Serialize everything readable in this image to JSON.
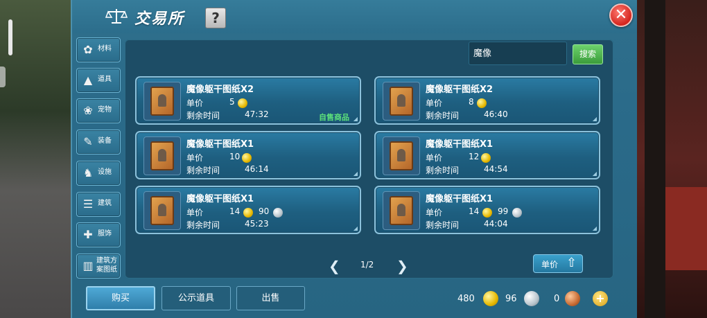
{
  "window": {
    "title": "交易所",
    "help_label": "?",
    "close_label": "✕"
  },
  "categories": [
    {
      "label": "材料",
      "icon": "materials-icon",
      "glyph": "✿"
    },
    {
      "label": "道具",
      "icon": "props-icon",
      "glyph": "▲"
    },
    {
      "label": "宠物",
      "icon": "pet-paw-icon",
      "glyph": "❀"
    },
    {
      "label": "装备",
      "icon": "sword-icon",
      "glyph": "✎"
    },
    {
      "label": "设施",
      "icon": "facility-icon",
      "glyph": "♞"
    },
    {
      "label": "建筑",
      "icon": "building-icon",
      "glyph": "☰"
    },
    {
      "label": "服饰",
      "icon": "clothing-icon",
      "glyph": "✚"
    },
    {
      "label": "建筑方案图纸",
      "icon": "blueprint-icon",
      "glyph": "▥"
    }
  ],
  "search": {
    "value": "魔像",
    "button_label": "搜索"
  },
  "listing_labels": {
    "price": "单价",
    "time_left": "剩余时间",
    "self_tag": "自售商品"
  },
  "listings": [
    {
      "name": "魔像躯干图纸X2",
      "gold": "5",
      "silver": "",
      "time": "47:32",
      "self": true
    },
    {
      "name": "魔像躯干图纸X2",
      "gold": "8",
      "silver": "",
      "time": "46:40",
      "self": false
    },
    {
      "name": "魔像躯干图纸X1",
      "gold": "10",
      "silver": "",
      "time": "46:14",
      "self": false
    },
    {
      "name": "魔像躯干图纸X1",
      "gold": "12",
      "silver": "",
      "time": "44:54",
      "self": false
    },
    {
      "name": "魔像躯干图纸X1",
      "gold": "14",
      "silver": "90",
      "time": "45:23",
      "self": false
    },
    {
      "name": "魔像躯干图纸X1",
      "gold": "14",
      "silver": "99",
      "time": "44:04",
      "self": false
    }
  ],
  "pager": {
    "text": "1/2",
    "prev": "❮",
    "next": "❯"
  },
  "sort_button": {
    "label": "单价",
    "icon": "sort-arrow-icon"
  },
  "bottom_tabs": {
    "buy": "购买",
    "public": "公示道具",
    "sell": "出售"
  },
  "currency": {
    "gold": "480",
    "silver": "96",
    "bronze": "0",
    "add": "+"
  },
  "colors": {
    "panel": "#2a6a89",
    "card": "#1e5f80",
    "self_tag": "#5ce07a",
    "search_button": "#3b9c3b",
    "close": "#d4251e"
  }
}
